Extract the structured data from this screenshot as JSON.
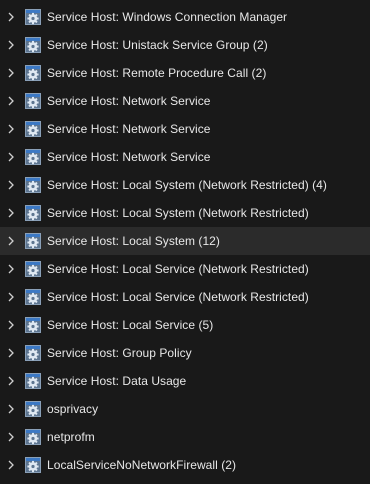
{
  "processes": [
    {
      "label": "Service Host: Windows Connection Manager",
      "icon": "gear-window-icon"
    },
    {
      "label": "Service Host: Unistack Service Group (2)",
      "icon": "gear-window-icon"
    },
    {
      "label": "Service Host: Remote Procedure Call (2)",
      "icon": "gear-window-icon"
    },
    {
      "label": "Service Host: Network Service",
      "icon": "gear-window-icon"
    },
    {
      "label": "Service Host: Network Service",
      "icon": "gear-window-icon"
    },
    {
      "label": "Service Host: Network Service",
      "icon": "gear-window-icon"
    },
    {
      "label": "Service Host: Local System (Network Restricted) (4)",
      "icon": "gear-window-icon"
    },
    {
      "label": "Service Host: Local System (Network Restricted)",
      "icon": "gear-window-icon"
    },
    {
      "label": "Service Host: Local System (12)",
      "icon": "gear-window-icon",
      "hovered": true
    },
    {
      "label": "Service Host: Local Service (Network Restricted)",
      "icon": "gear-window-icon"
    },
    {
      "label": "Service Host: Local Service (Network Restricted)",
      "icon": "gear-window-icon"
    },
    {
      "label": "Service Host: Local Service (5)",
      "icon": "gear-window-icon"
    },
    {
      "label": "Service Host: Group Policy",
      "icon": "gear-window-icon"
    },
    {
      "label": "Service Host: Data Usage",
      "icon": "gear-window-icon"
    },
    {
      "label": "osprivacy",
      "icon": "gear-window-icon"
    },
    {
      "label": "netprofm",
      "icon": "gear-window-icon"
    },
    {
      "label": "LocalServiceNoNetworkFirewall (2)",
      "icon": "gear-window-icon"
    }
  ],
  "colors": {
    "background": "#191919",
    "hover_row": "#2b2b2b",
    "text": "#e8e8e8",
    "chevron": "#cfcfcf",
    "icon_frame": "#6a7f98",
    "icon_title": "#3b78c4",
    "icon_gear": "#dfe8f2"
  }
}
